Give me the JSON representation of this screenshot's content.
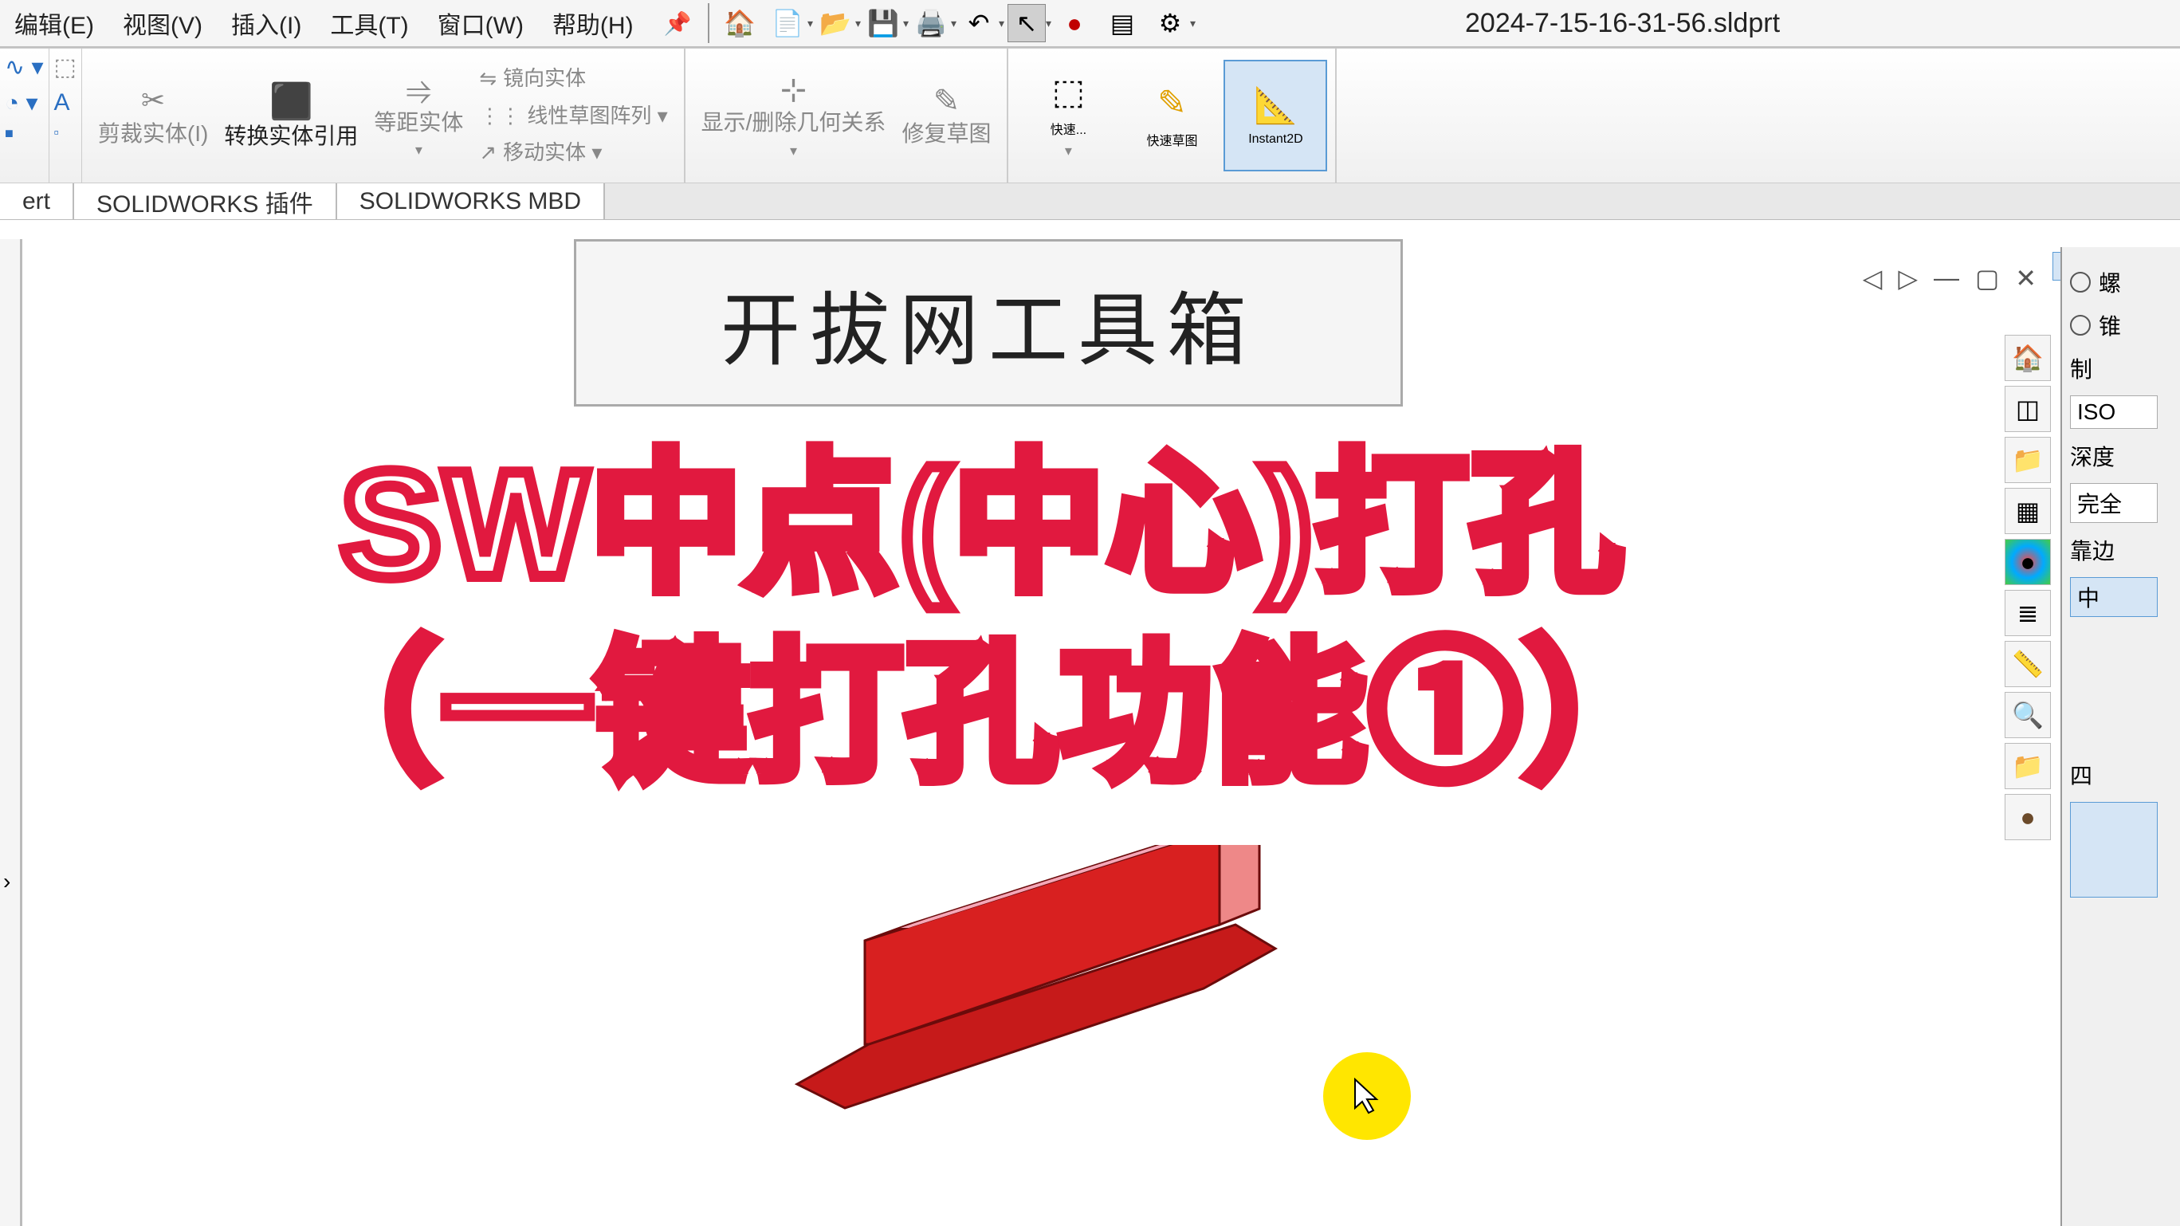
{
  "topmenu": {
    "edit": "编辑(E)",
    "view": "视图(V)",
    "insert": "插入(I)",
    "tools": "工具(T)",
    "window": "窗口(W)",
    "help": "帮助(H)"
  },
  "filename": "2024-7-15-16-31-56.sldprt",
  "ribbon": {
    "trim": "剪裁实体(I)",
    "convert": "转换实体引用",
    "offset": "等距实体",
    "mirror": "镜向实体",
    "pattern": "线性草图阵列",
    "move": "移动实体",
    "showdel": "显示/删除几何关系",
    "repair": "修复草图",
    "rapid": "快速...",
    "rapidsketch": "快速草图",
    "instant2d": "Instant2D"
  },
  "tabs": {
    "insertshort": "ert",
    "addin": "SOLIDWORKS 插件",
    "mbd": "SOLIDWORKS MBD"
  },
  "kaiba": "开拔网工具箱",
  "overlay": {
    "line1": "SW中点(中心)打孔",
    "line2": "（一键打孔功能①）"
  },
  "taskpane": {
    "opt1": "螺",
    "opt2": "锥",
    "sec1": "制",
    "field1": "ISO",
    "sec2": "深度",
    "field2": "完全",
    "sec3": "靠边",
    "field3": "中",
    "sec4": "四"
  }
}
